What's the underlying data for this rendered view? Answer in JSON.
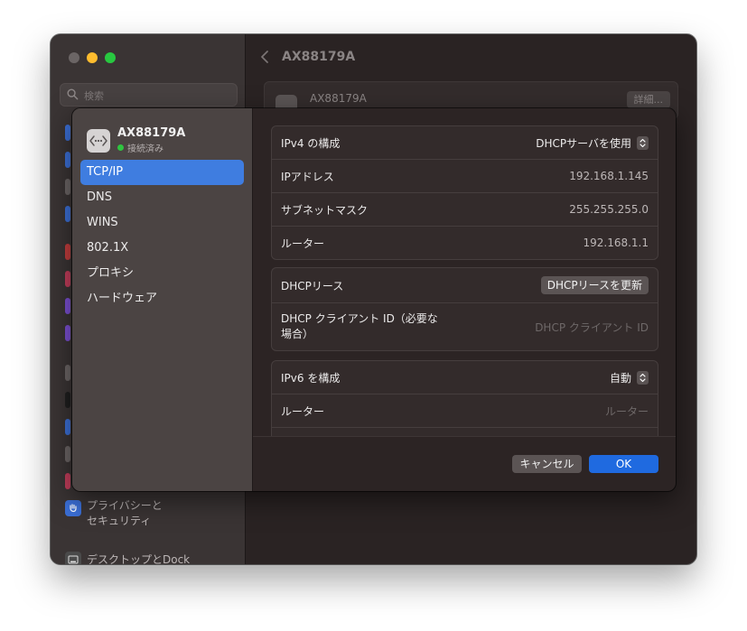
{
  "window": {
    "title": "AX88179A",
    "search_placeholder": "検索",
    "card_name": "AX88179A",
    "details_button": "詳細...",
    "sidebar_visible": [
      {
        "label": "プライバシーと\nセキュリティ",
        "icon": "hand-icon",
        "color": "#3b6fd6"
      },
      {
        "label": "デスクトップとDock",
        "icon": "dock-icon",
        "color": "#4a4a4a"
      }
    ]
  },
  "dialog": {
    "device": {
      "name": "AX88179A",
      "status": "接続済み",
      "status_color": "#2fc540"
    },
    "nav": [
      {
        "label": "TCP/IP",
        "active": true
      },
      {
        "label": "DNS",
        "active": false
      },
      {
        "label": "WINS",
        "active": false
      },
      {
        "label": "802.1X",
        "active": false
      },
      {
        "label": "プロキシ",
        "active": false
      },
      {
        "label": "ハードウェア",
        "active": false
      }
    ],
    "ipv4": {
      "config_label": "IPv4 の構成",
      "config_value": "DHCPサーバを使用",
      "ip_label": "IPアドレス",
      "ip_value": "192.168.1.145",
      "subnet_label": "サブネットマスク",
      "subnet_value": "255.255.255.0",
      "router_label": "ルーター",
      "router_value": "192.168.1.1"
    },
    "dhcp": {
      "lease_label": "DHCPリース",
      "renew_button": "DHCPリースを更新",
      "client_id_label": "DHCP クライアント ID（必要な場合）",
      "client_id_placeholder": "DHCP クライアント ID"
    },
    "ipv6": {
      "config_label": "IPv6 を構成",
      "config_value": "自動",
      "router_label": "ルーター",
      "router_placeholder": "ルーター"
    },
    "buttons": {
      "cancel": "キャンセル",
      "ok": "OK"
    },
    "accent_color": "#3f7de0"
  }
}
